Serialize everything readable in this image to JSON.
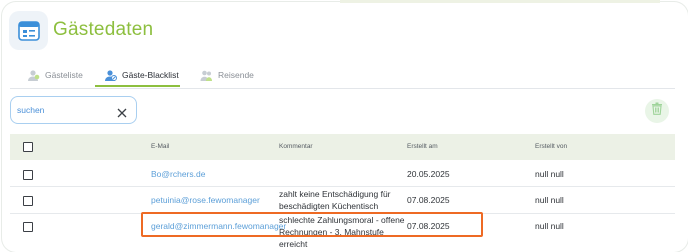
{
  "header": {
    "title": "Gästedaten"
  },
  "tabs": [
    {
      "label": "Gästeliste",
      "icon": "guest-list-icon",
      "active": false
    },
    {
      "label": "Gäste-Blacklist",
      "icon": "guest-blacklist-icon",
      "active": true
    },
    {
      "label": "Reisende",
      "icon": "travelers-icon",
      "active": false
    }
  ],
  "search": {
    "placeholder": "suchen",
    "value": ""
  },
  "table": {
    "headers": {
      "email": "E-Mail",
      "comment": "Kommentar",
      "created_at": "Erstellt am",
      "created_by": "Erstellt von"
    },
    "rows": [
      {
        "email": "Bo@rchers.de",
        "comment": "",
        "created_at": "20.05.2025",
        "created_by": "null null"
      },
      {
        "email": "petuinia@rose.fewomanager",
        "comment": "zahlt keine Entschädigung für beschädigten Küchentisch",
        "created_at": "07.08.2025",
        "created_by": "null null"
      },
      {
        "email": "gerald@zimmermann.fewomanager",
        "comment": "schlechte Zahlungsmoral - offene Rechnungen - 3. Mahnstufe erreicht",
        "created_at": "07.08.2025",
        "created_by": "null null"
      }
    ]
  },
  "colors": {
    "accent": "#8dbf3f",
    "link": "#5c9fd8",
    "highlight": "#ee6a24"
  }
}
